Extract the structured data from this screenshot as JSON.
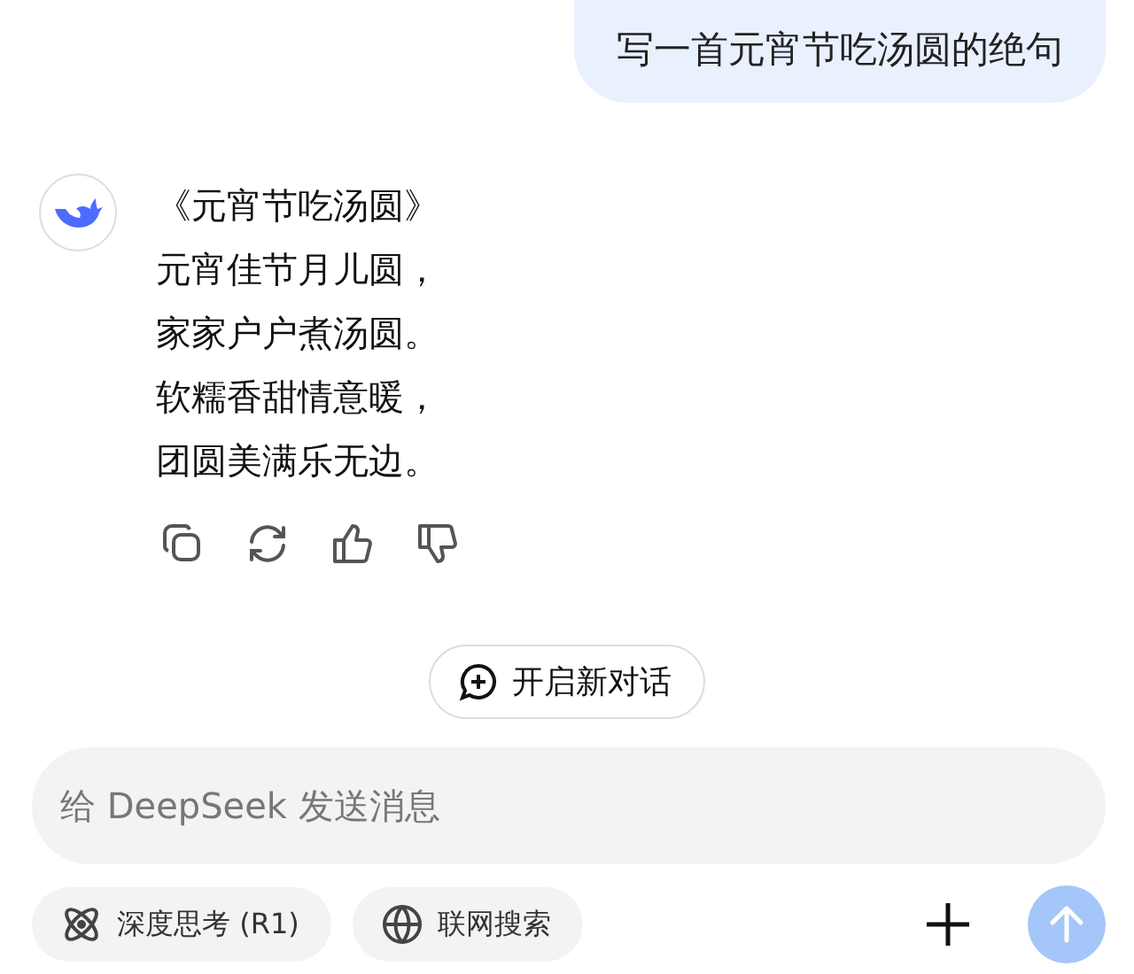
{
  "user_message": {
    "text": "写一首元宵节吃汤圆的绝句"
  },
  "assistant_message": {
    "lines": [
      "《元宵节吃汤圆》",
      "元宵佳节月儿圆，",
      "家家户户煮汤圆。",
      "软糯香甜情意暖，",
      "团圆美满乐无边。"
    ]
  },
  "message_actions": [
    {
      "kind": "copy"
    },
    {
      "kind": "regenerate"
    },
    {
      "kind": "like"
    },
    {
      "kind": "dislike"
    }
  ],
  "new_chat_button": {
    "label": "开启新对话"
  },
  "composer": {
    "placeholder": "给 DeepSeek 发送消息",
    "toggles": [
      {
        "kind": "deepthink",
        "label": "深度思考 (R1)",
        "selected": false
      },
      {
        "kind": "search",
        "label": "联网搜索",
        "selected": false
      }
    ],
    "send_disabled": true
  }
}
